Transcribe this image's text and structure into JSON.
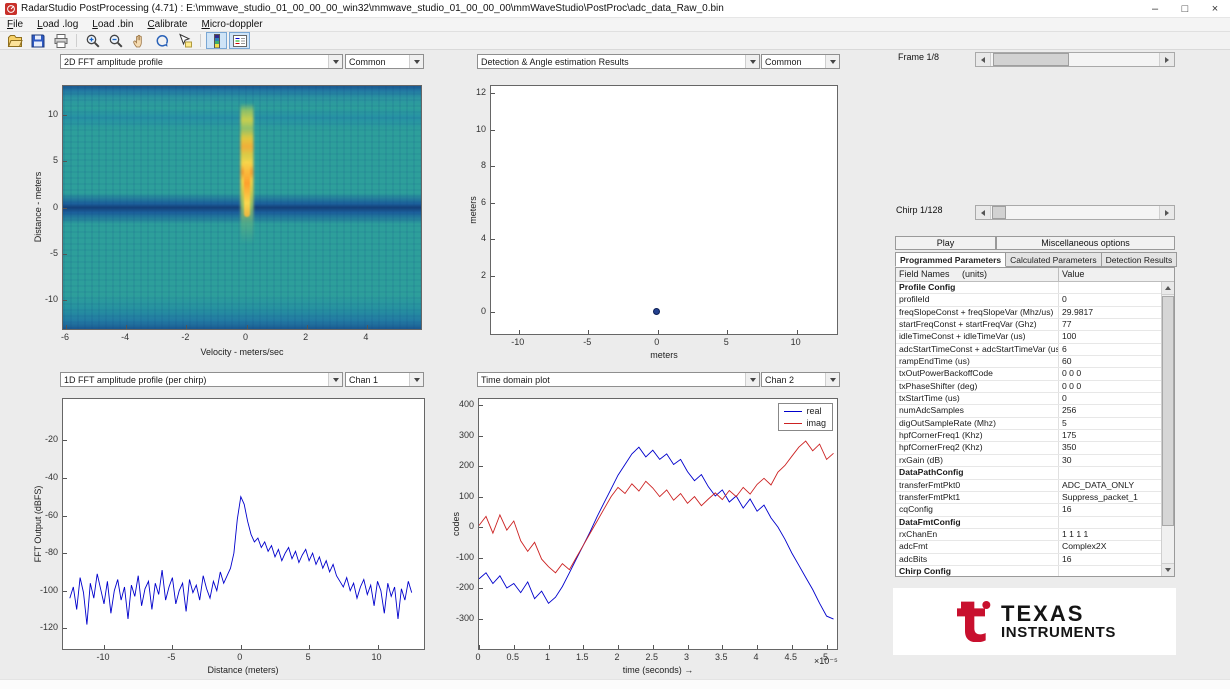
{
  "window": {
    "title": "RadarStudio PostProcessing (4.71)  : E:\\mmwave_studio_01_00_00_00_win32\\mmwave_studio_01_00_00_00\\mmWaveStudio\\PostProc\\adc_data_Raw_0.bin",
    "controls": {
      "minimize": "–",
      "maximize": "□",
      "close": "×"
    }
  },
  "menu_bar": {
    "items": [
      "File",
      "Load .log",
      "Load .bin",
      "Calibrate",
      "Micro-doppler"
    ]
  },
  "toolbar": {
    "icons": [
      "open",
      "save",
      "print",
      "zoom-in",
      "zoom-out",
      "pan",
      "rotate",
      "data-cursor",
      "colorbar",
      "legend"
    ],
    "active_icons": [
      "colorbar",
      "legend"
    ]
  },
  "selectors": {
    "range_doppler": {
      "plot": "2D FFT amplitude profile",
      "channel": "Common"
    },
    "detection": {
      "plot": "Detection & Angle estimation Results",
      "channel": "Common"
    },
    "fft1d": {
      "plot": "1D FFT amplitude profile (per chirp)",
      "channel": "Chan 1"
    },
    "timedomain": {
      "plot": "Time domain plot",
      "channel": "Chan 2"
    }
  },
  "right_panel": {
    "frame_label": "Frame 1/8",
    "chirp_label": "Chirp 1/128",
    "play_button": "Play",
    "misc_button": "Miscellaneous options",
    "tabs": [
      "Programmed Parameters",
      "Calculated Parameters",
      "Detection Results"
    ],
    "active_tab_index": 0,
    "table": {
      "headers": [
        "Field Names     (units)",
        "Value"
      ],
      "rows": [
        {
          "field": "Profile Config",
          "value": "",
          "section": true
        },
        {
          "field": "profileId",
          "value": "0"
        },
        {
          "field": "freqSlopeConst + freqSlopeVar (Mhz/us)",
          "value": "29.9817"
        },
        {
          "field": "startFreqConst + startFreqVar (Ghz)",
          "value": "77"
        },
        {
          "field": "idleTimeConst + idleTimeVar (us)",
          "value": "100"
        },
        {
          "field": "adcStartTimeConst + adcStartTimeVar (us)",
          "value": "6"
        },
        {
          "field": "rampEndTime (us)",
          "value": "60"
        },
        {
          "field": "txOutPowerBackoffCode",
          "value": "0 0 0"
        },
        {
          "field": "txPhaseShifter (deg)",
          "value": "0 0 0"
        },
        {
          "field": "txStartTime (us)",
          "value": "0"
        },
        {
          "field": "numAdcSamples",
          "value": "256"
        },
        {
          "field": "digOutSampleRate (Mhz)",
          "value": "5"
        },
        {
          "field": "hpfCornerFreq1 (Khz)",
          "value": "175"
        },
        {
          "field": "hpfCornerFreq2 (Khz)",
          "value": "350"
        },
        {
          "field": "rxGain (dB)",
          "value": "30"
        },
        {
          "field": "DataPathConfig",
          "value": "",
          "section": true
        },
        {
          "field": "transferFmtPkt0",
          "value": "ADC_DATA_ONLY"
        },
        {
          "field": "transferFmtPkt1",
          "value": "Suppress_packet_1"
        },
        {
          "field": "cqConfig",
          "value": "16"
        },
        {
          "field": "DataFmtConfig",
          "value": "",
          "section": true
        },
        {
          "field": "rxChanEn",
          "value": "1 1 1 1"
        },
        {
          "field": "adcFmt",
          "value": "Complex2X"
        },
        {
          "field": "adcBits",
          "value": "16"
        },
        {
          "field": "Chirp Config",
          "value": "",
          "section": true
        }
      ]
    },
    "logo_line1": "TEXAS",
    "logo_line2": "INSTRUMENTS",
    "logo_color": "#c8102e"
  },
  "chart_data": [
    {
      "id": "range_doppler",
      "type": "heatmap",
      "xlabel": "Velocity - meters/sec",
      "ylabel": "Distance - meters",
      "xlim": [
        -6.1,
        5.8
      ],
      "ylim": [
        -13.2,
        13.2
      ],
      "xticks": [
        -6,
        -4,
        -2,
        0,
        2,
        4
      ],
      "yticks": [
        -10,
        -5,
        0,
        5,
        10
      ],
      "description": "2D range-doppler FFT magnitude: teal low-amplitude background, dark blue bands at distance 0 and at map edges, bright yellow-orange target return column at velocity 0 spanning distance approx -2 to 11 m",
      "palette": {
        "low": "#143f77",
        "mid": "#2d9f9b",
        "high": "#f6d54a",
        "hot": "#ff9d2c"
      }
    },
    {
      "id": "detection",
      "type": "scatter",
      "xlabel": "meters",
      "ylabel": "meters",
      "xlim": [
        -12,
        12.9
      ],
      "ylim": [
        -1.2,
        12.4
      ],
      "xticks": [
        -10,
        -5,
        0,
        5,
        10
      ],
      "yticks": [
        0,
        2,
        4,
        6,
        8,
        10,
        12
      ],
      "points": [
        {
          "x": -0.1,
          "y": 0.05
        }
      ],
      "marker_color": "#24418f"
    },
    {
      "id": "fft1d",
      "type": "line",
      "xlabel": "Distance (meters)",
      "ylabel": "FFT Output (dBFS)",
      "xlim": [
        -13,
        13.4
      ],
      "ylim": [
        -131,
        2
      ],
      "xticks": [
        -10,
        -5,
        0,
        5,
        10
      ],
      "yticks": [
        -120,
        -100,
        -80,
        -60,
        -40,
        -20
      ],
      "series": [
        {
          "name": "Chan 1",
          "color": "#0000cc",
          "x_start": -12.5,
          "x_step": 0.25,
          "values": [
            -104,
            -98,
            -110,
            -93,
            -101,
            -118,
            -96,
            -104,
            -91,
            -99,
            -107,
            -95,
            -112,
            -100,
            -94,
            -105,
            -98,
            -115,
            -97,
            -103,
            -92,
            -108,
            -99,
            -95,
            -110,
            -96,
            -102,
            -89,
            -105,
            -98,
            -93,
            -107,
            -100,
            -96,
            -111,
            -94,
            -101,
            -97,
            -105,
            -92,
            -99,
            -104,
            -95,
            -100,
            -90,
            -96,
            -92,
            -88,
            -80,
            -62,
            -50,
            -54,
            -63,
            -70,
            -74,
            -72,
            -77,
            -74,
            -79,
            -76,
            -82,
            -78,
            -84,
            -80,
            -77,
            -83,
            -79,
            -85,
            -81,
            -78,
            -84,
            -80,
            -86,
            -82,
            -88,
            -84,
            -90,
            -86,
            -92,
            -95,
            -98,
            -93,
            -100,
            -96,
            -104,
            -98,
            -94,
            -102,
            -97,
            -108,
            -95,
            -100,
            -112,
            -96,
            -103,
            -98,
            -115,
            -99,
            -105,
            -95,
            -101
          ]
        }
      ]
    },
    {
      "id": "timedomain",
      "type": "line",
      "xlabel": "time  (seconds) →",
      "ylabel": "codes",
      "x_multiplier": "×10⁻⁵",
      "xlim": [
        0,
        5.15
      ],
      "ylim": [
        -400,
        420
      ],
      "xticks": [
        0,
        0.5,
        1,
        1.5,
        2,
        2.5,
        3,
        3.5,
        4,
        4.5,
        5
      ],
      "xtick_labels": [
        "0",
        "0.5",
        "1",
        "1.5",
        "2",
        "2.5",
        "3",
        "3.5",
        "4",
        "4.5",
        "5"
      ],
      "yticks": [
        -300,
        -200,
        -100,
        0,
        100,
        200,
        300,
        400
      ],
      "legend": [
        "real",
        "imag"
      ],
      "series": [
        {
          "name": "real",
          "color": "#0000cc",
          "x_start": 0,
          "x_step": 0.1,
          "values": [
            -170,
            -150,
            -185,
            -160,
            -200,
            -185,
            -215,
            -180,
            -235,
            -210,
            -250,
            -230,
            -195,
            -150,
            -105,
            -60,
            -15,
            35,
            80,
            125,
            170,
            205,
            240,
            262,
            230,
            252,
            222,
            240,
            205,
            222,
            182,
            152,
            172,
            132,
            102,
            122,
            82,
            102,
            62,
            92,
            52,
            72,
            30,
            0,
            -40,
            -85,
            -125,
            -165,
            -205,
            -250,
            -292,
            -302
          ]
        },
        {
          "name": "imag",
          "color": "#cc2222",
          "x_start": 0,
          "x_step": 0.1,
          "values": [
            5,
            35,
            -20,
            40,
            -10,
            20,
            -45,
            -80,
            -50,
            -105,
            -130,
            -150,
            -120,
            -140,
            -100,
            -60,
            -20,
            20,
            60,
            100,
            130,
            110,
            142,
            118,
            150,
            128,
            100,
            122,
            88,
            110,
            78,
            100,
            70,
            92,
            112,
            90,
            120,
            100,
            130,
            108,
            140,
            160,
            138,
            180,
            202,
            232,
            262,
            282,
            250,
            272,
            222,
            242
          ]
        }
      ]
    }
  ]
}
